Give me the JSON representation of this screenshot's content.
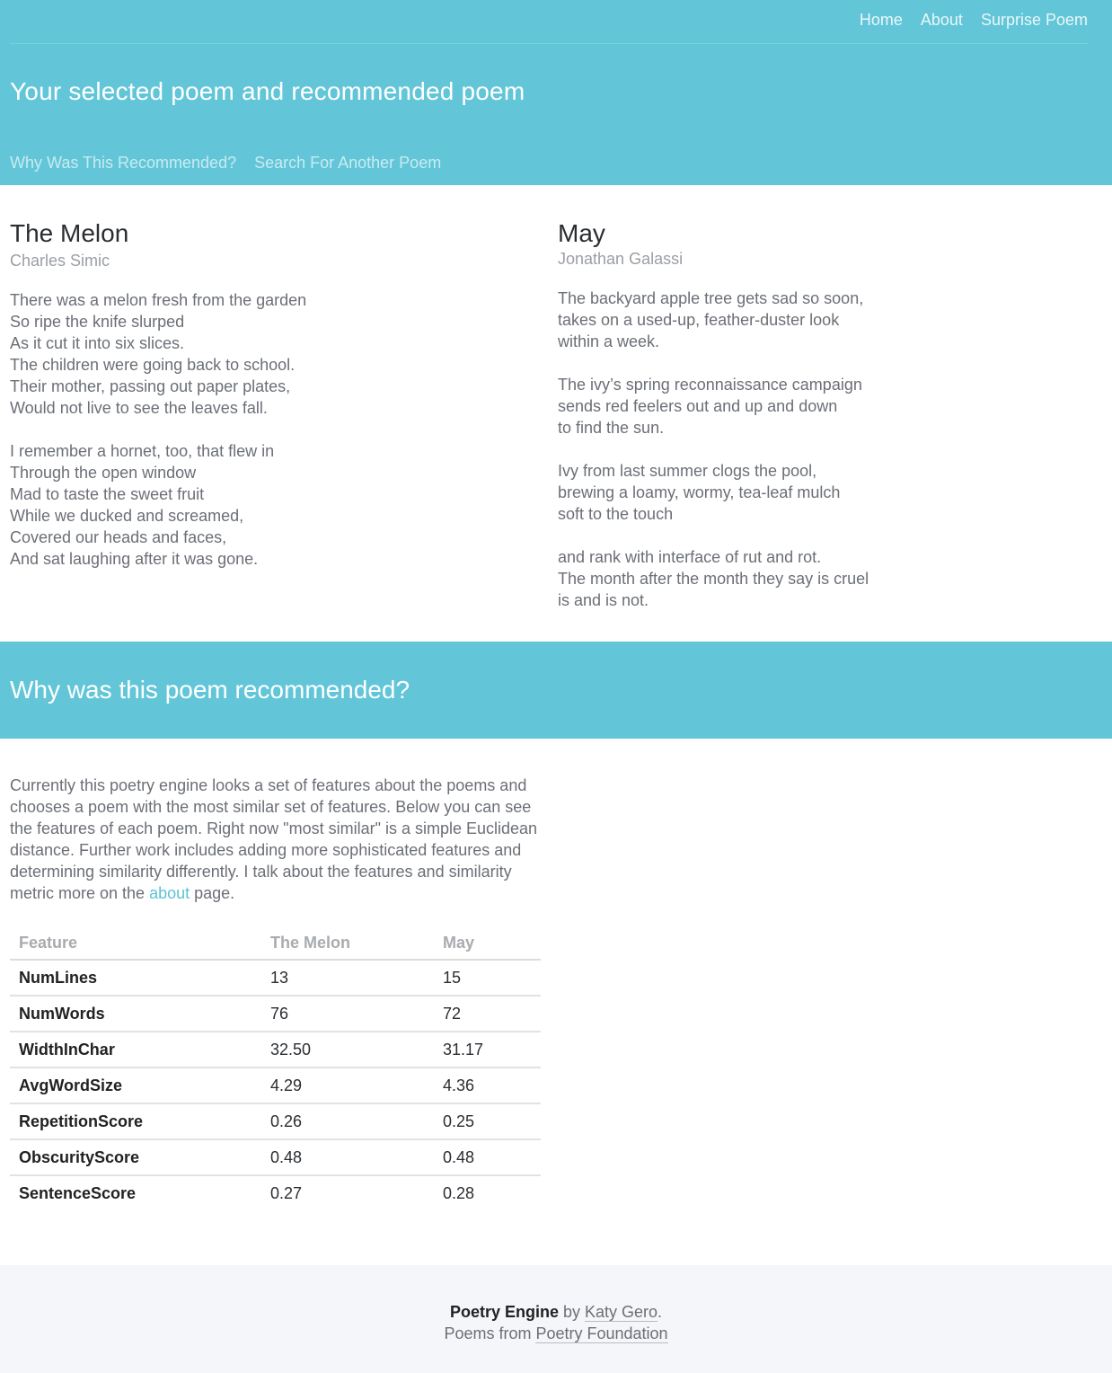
{
  "nav": {
    "home": "Home",
    "about": "About",
    "surprise": "Surprise Poem"
  },
  "header": {
    "title": "Your selected poem and recommended poem",
    "why_link": "Why Was This Recommended?",
    "search_link": "Search For Another Poem"
  },
  "selected_poem": {
    "title": "The Melon",
    "author": "Charles Simic",
    "stanzas": [
      [
        "There was a melon fresh from the garden",
        "So ripe the knife slurped",
        "As it cut it into six slices.",
        "The children were going back to school.",
        "Their mother, passing out paper plates,",
        "Would not live to see the leaves fall."
      ],
      [
        "I remember a hornet, too, that flew in",
        "Through the open window",
        "Mad to taste the sweet fruit",
        "While we ducked and screamed,",
        "Covered our heads and faces,",
        "And sat laughing after it was gone."
      ]
    ]
  },
  "recommended_poem": {
    "title": "May",
    "author": "Jonathan Galassi",
    "stanzas": [
      [
        "The backyard apple tree gets sad so soon,",
        "takes on a used-up, feather-duster look",
        "within a week."
      ],
      [
        "The ivy’s spring reconnaissance campaign",
        "sends red feelers out and up and down",
        "to find the sun."
      ],
      [
        "Ivy from last summer clogs the pool,",
        "brewing a loamy, wormy, tea-leaf mulch",
        "soft to the touch"
      ],
      [
        "and rank with interface of rut and rot.",
        "The month after the month they say is cruel",
        "is and is not."
      ]
    ]
  },
  "why": {
    "title": "Why was this poem recommended?",
    "text_before": "Currently this poetry engine looks a set of features about the poems and chooses a poem with the most similar set of features. Below you can see the features of each poem. Right now \"most similar\" is a simple Euclidean distance. Further work includes adding more sophisticated features and determining similarity differently. I talk about the features and similarity metric more on the ",
    "link_text": "about",
    "text_after": " page."
  },
  "table": {
    "headers": [
      "Feature",
      "The Melon",
      "May"
    ],
    "rows": [
      [
        "NumLines",
        "13",
        "15"
      ],
      [
        "NumWords",
        "76",
        "72"
      ],
      [
        "WidthInChar",
        "32.50",
        "31.17"
      ],
      [
        "AvgWordSize",
        "4.29",
        "4.36"
      ],
      [
        "RepetitionScore",
        "0.26",
        "0.25"
      ],
      [
        "ObscurityScore",
        "0.48",
        "0.48"
      ],
      [
        "SentenceScore",
        "0.27",
        "0.28"
      ]
    ]
  },
  "footer": {
    "brand": "Poetry Engine",
    "by": " by ",
    "author_link": "Katy Gero",
    "period": ".",
    "poems_from": "Poems from ",
    "source_link": "Poetry Foundation"
  },
  "colors": {
    "accent": "#62c6d8",
    "link": "#5cc3d6",
    "footer_bg": "#f5f6f9"
  }
}
